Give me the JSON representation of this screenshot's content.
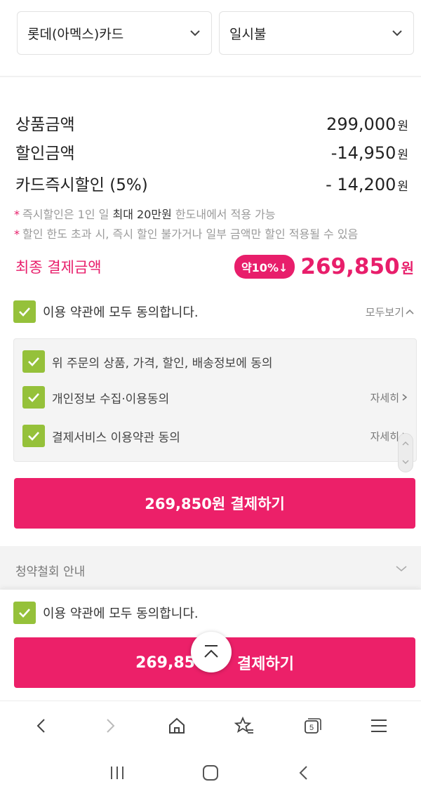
{
  "payment": {
    "card_select": "롯데(아멕스)카드",
    "installment_select": "일시불"
  },
  "summary": {
    "product_label": "상품금액",
    "product_value": "299,000",
    "discount_label": "할인금액",
    "discount_value": "-14,950",
    "card_discount_label": "카드즉시할인 (5%)",
    "card_discount_value": "- 14,200",
    "won": "원"
  },
  "notes": {
    "star": "*",
    "note1_pre": "즉시할인은 1인 일",
    "note1_bold": "최대 20만원",
    "note1_post": "한도내에서 적용 가능",
    "note2": "할인 한도 초과 시, 즉시 할인 불가거나 일부 금액만 할인 적용될 수 있음"
  },
  "final": {
    "label": "최종 결제금액",
    "badge": "약10%↓",
    "amount": "269,850",
    "won": "원"
  },
  "agreement": {
    "all_label": "이용 약관에 모두 동의합니다.",
    "view_all": "모두보기",
    "items": [
      {
        "label": "위 주문의 상품, 가격, 할인, 배송정보에 동의",
        "detail": ""
      },
      {
        "label": "개인정보 수집·이용동의",
        "detail": "자세히"
      },
      {
        "label": "결제서비스 이용약관 동의",
        "detail": "자세히"
      }
    ]
  },
  "pay_button": "269,850원 결제하기",
  "withdrawal": "청약철회 안내",
  "sticky": {
    "agree_label": "이용 약관에 모두 동의합니다.",
    "pay_button_left": "269,85",
    "pay_button_right": "결제하기"
  },
  "browser_nav": {
    "tabs_count": "5"
  },
  "colors": {
    "accent": "#ec2069",
    "checkbox": "#95c13a"
  }
}
